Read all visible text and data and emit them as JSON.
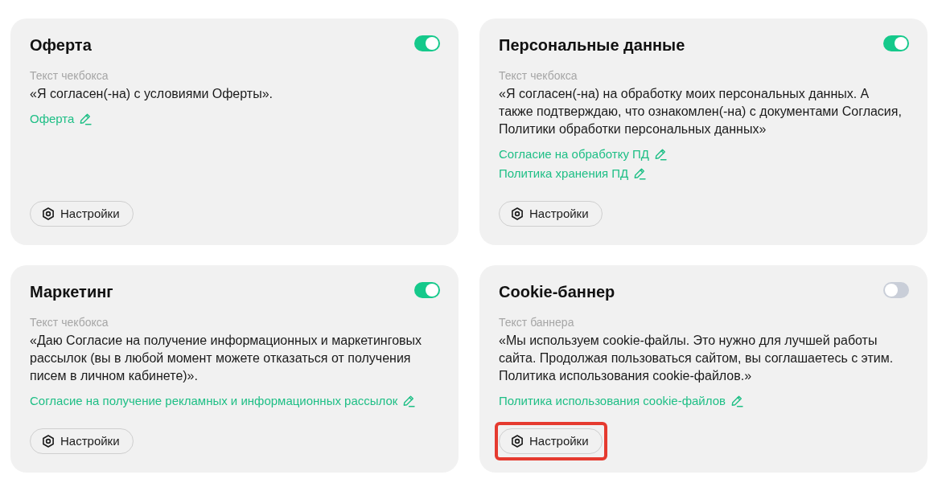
{
  "cards": [
    {
      "title": "Оферта",
      "enabled": true,
      "text_label": "Текст чекбокса",
      "text": "«Я согласен(-на) с условиями Оферты».",
      "links": [
        "Оферта"
      ],
      "settings_button": "Настройки",
      "highlighted": false
    },
    {
      "title": "Персональные данные",
      "enabled": true,
      "text_label": "Текст чекбокса",
      "text": "«Я согласен(-на) на обработку моих персональных данных. А также подтверждаю, что ознакомлен(-на) с документами Согласия, Политики обработки персональных данных»",
      "links": [
        "Согласие на обработку ПД",
        "Политика хранения ПД"
      ],
      "settings_button": "Настройки",
      "highlighted": false
    },
    {
      "title": "Маркетинг",
      "enabled": true,
      "text_label": "Текст чекбокса",
      "text": "«Даю Согласие на получение информационных и маркетинговых рассылок (вы в любой момент можете отказаться от получения писем в личном кабинете)».",
      "links": [
        "Согласие на получение рекламных и информационных рассылок"
      ],
      "settings_button": "Настройки",
      "highlighted": false
    },
    {
      "title": "Cookie-баннер",
      "enabled": false,
      "text_label": "Текст баннера",
      "text": "«Мы используем cookie-файлы. Это нужно для лучшей работы сайта. Продолжая пользоваться сайтом, вы соглашаетесь с этим. Политика использования cookie-файлов.»",
      "links": [
        "Политика использования cookie-файлов"
      ],
      "settings_button": "Настройки",
      "highlighted": true
    }
  ]
}
